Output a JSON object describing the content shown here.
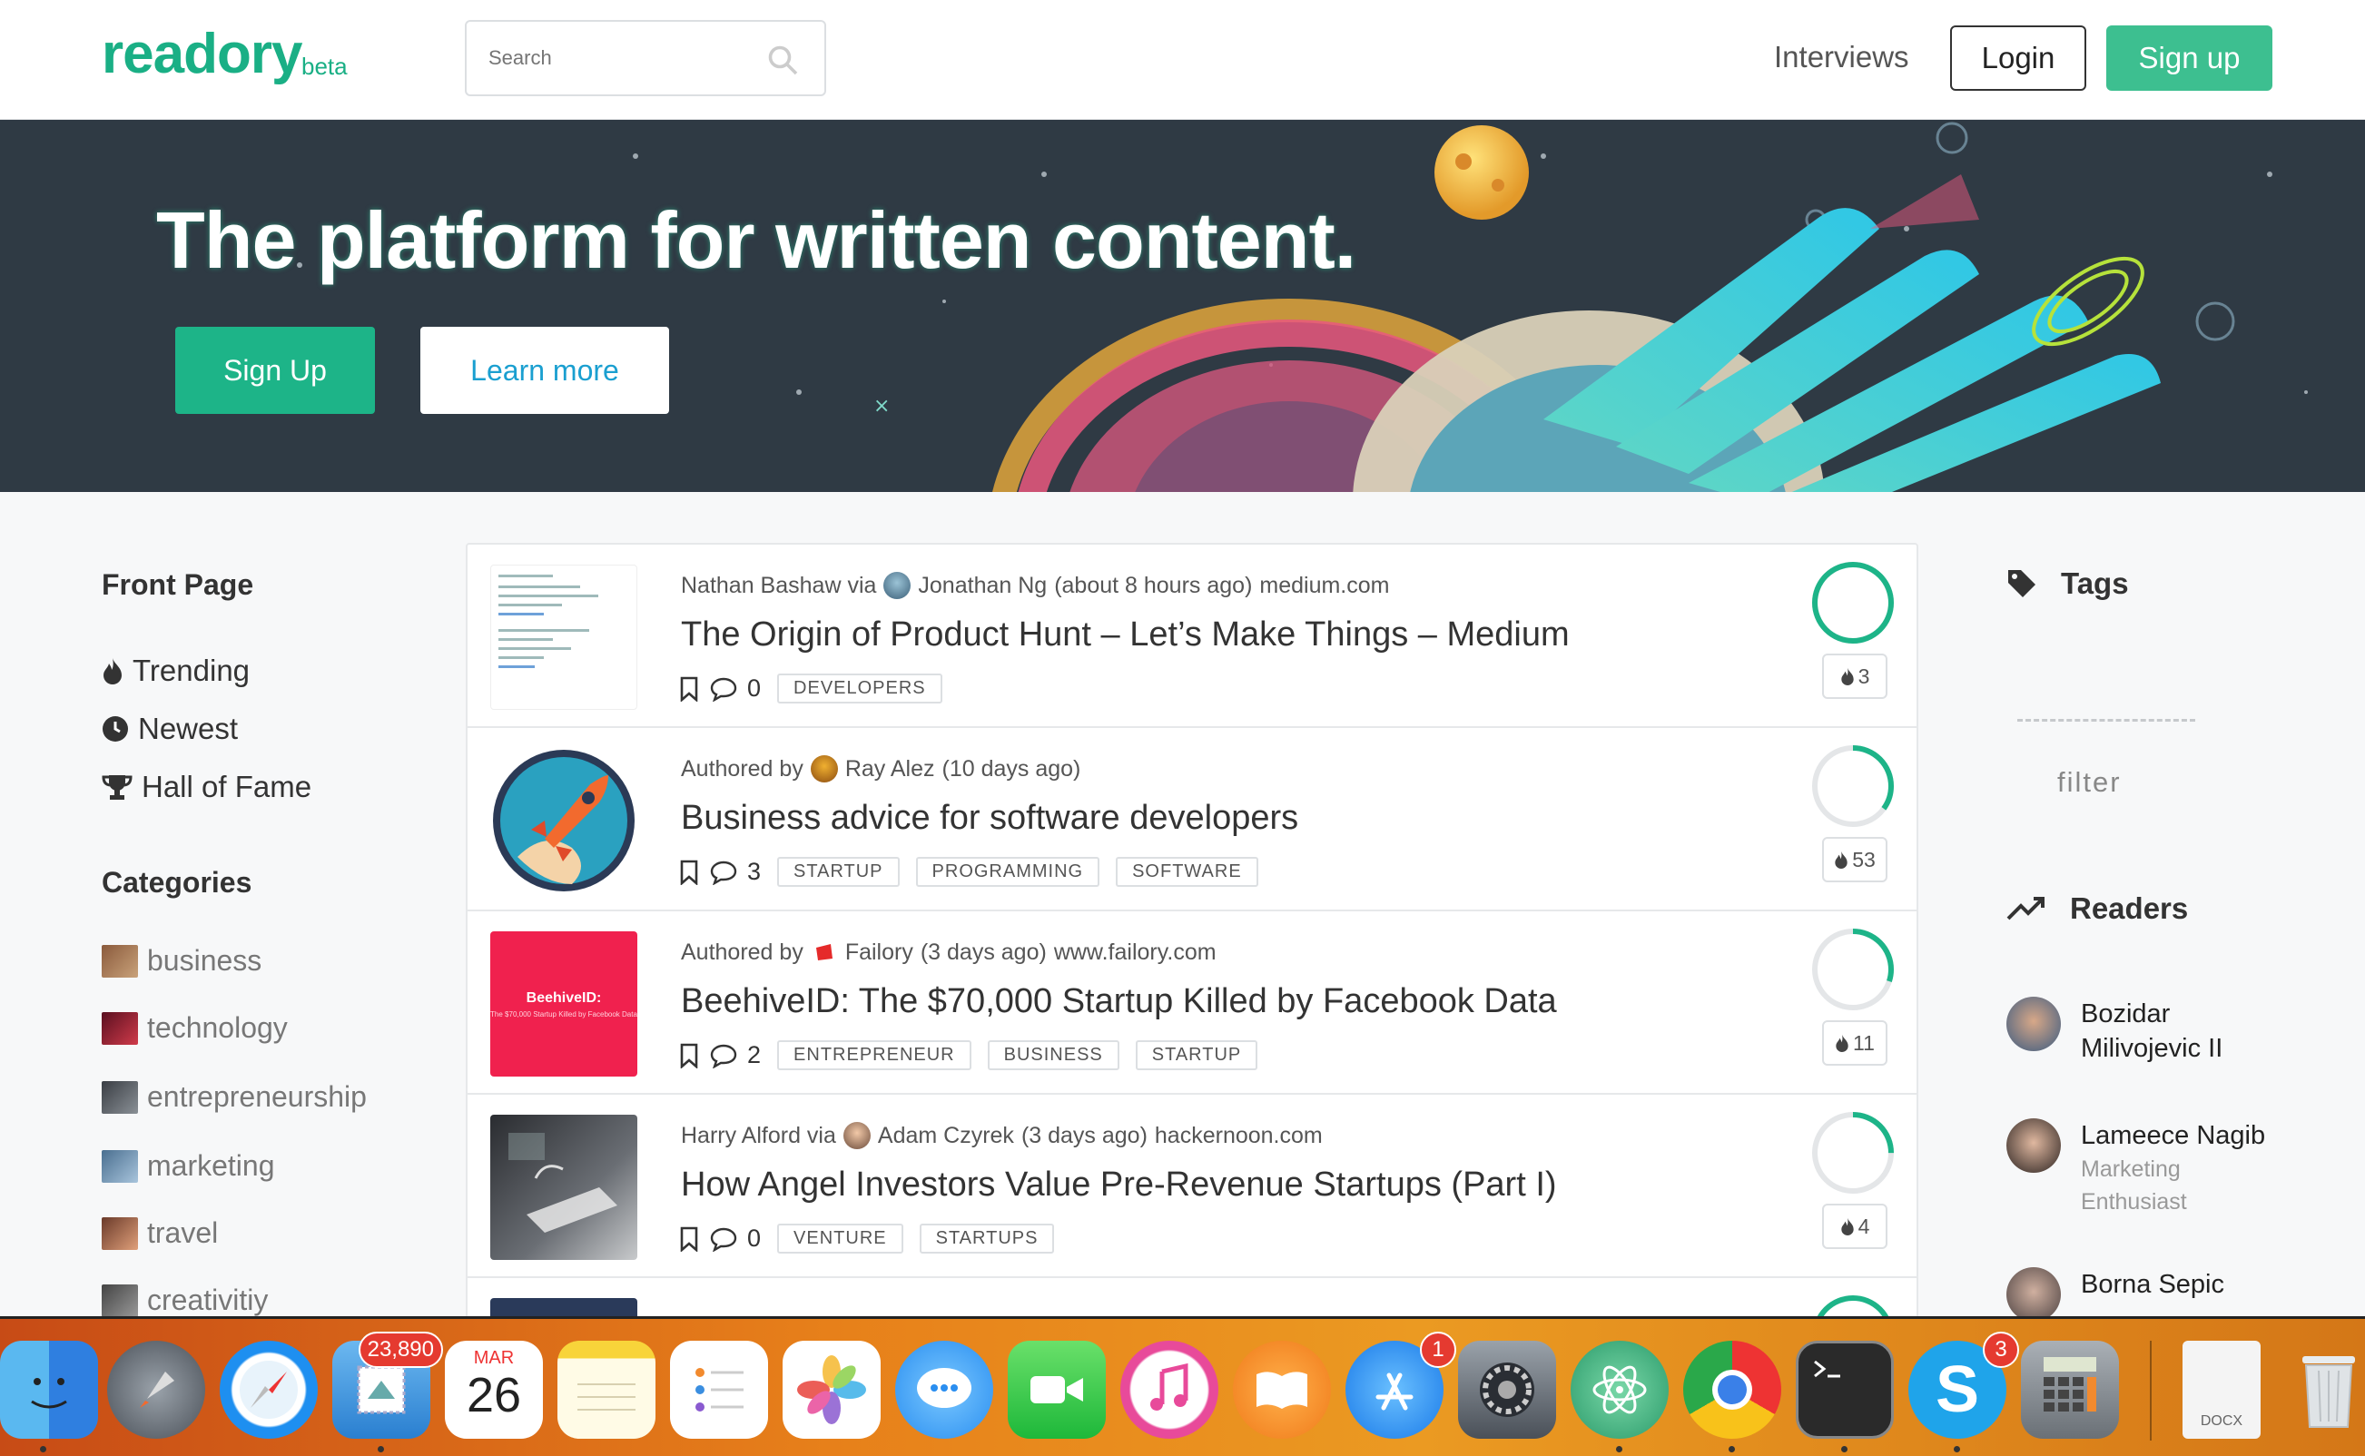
{
  "header": {
    "logo": "readory",
    "badge": "beta",
    "search_placeholder": "Search",
    "nav_interviews": "Interviews",
    "login_label": "Login",
    "signup_label": "Sign up"
  },
  "hero": {
    "title": "The platform for written content.",
    "signup_label": "Sign Up",
    "learn_more_label": "Learn more"
  },
  "sidebar": {
    "front_page_title": "Front Page",
    "nav": [
      {
        "label": "Trending",
        "icon": "flame-icon"
      },
      {
        "label": "Newest",
        "icon": "clock-icon"
      },
      {
        "label": "Hall of Fame",
        "icon": "trophy-icon"
      }
    ],
    "categories_title": "Categories",
    "categories": [
      {
        "label": "business",
        "color": "#8a5a3c"
      },
      {
        "label": "technology",
        "color": "#9a1f2c"
      },
      {
        "label": "entrepreneurship",
        "color": "#555a60"
      },
      {
        "label": "marketing",
        "color": "#6a8fb0"
      },
      {
        "label": "travel",
        "color": "#b06a4a"
      },
      {
        "label": "creativitiy",
        "color": "#6a6a6a"
      }
    ]
  },
  "feed": [
    {
      "author_prefix": "Nathan Bashaw via",
      "author": "Jonathan Ng",
      "time": "(about 8 hours ago)",
      "source": "medium.com",
      "title": "The Origin of Product Hunt – Let’s Make Things – Medium",
      "comments": "0",
      "tags": [
        "DEVELOPERS"
      ],
      "score": "3",
      "progress": 1.0
    },
    {
      "author_prefix": "Authored by",
      "author": "Ray Alez",
      "time": "(10 days ago)",
      "source": "",
      "title": "Business advice for software developers",
      "comments": "3",
      "tags": [
        "STARTUP",
        "PROGRAMMING",
        "SOFTWARE"
      ],
      "score": "53",
      "progress": 0.35
    },
    {
      "author_prefix": "Authored by",
      "author": "Failory",
      "time": "(3 days ago)",
      "source": "www.failory.com",
      "title": "BeehiveID: The $70,000 Startup Killed by Facebook Data",
      "comments": "2",
      "tags": [
        "ENTREPRENEUR",
        "BUSINESS",
        "STARTUP"
      ],
      "score": "11",
      "progress": 0.3,
      "thumb_text": "BeehiveID:",
      "thumb_sub": "The $70,000 Startup Killed by Facebook Data"
    },
    {
      "author_prefix": "Harry Alford via",
      "author": "Adam Czyrek",
      "time": "(3 days ago)",
      "source": "hackernoon.com",
      "title": "How Angel Investors Value Pre-Revenue Startups (Part I)",
      "comments": "0",
      "tags": [
        "VENTURE",
        "STARTUPS"
      ],
      "score": "4",
      "progress": 0.25
    }
  ],
  "right": {
    "tags_title": "Tags",
    "filter_label": "filter",
    "readers_title": "Readers",
    "readers": [
      {
        "name": "Bozidar Milivojevic II",
        "desc": ""
      },
      {
        "name": "Lameece Nagib",
        "desc": "Marketing Enthusiast"
      },
      {
        "name": "Borna Sepic",
        "desc": ""
      }
    ]
  },
  "dock": {
    "mail_badge": "23,890",
    "calendar_month": "MAR",
    "calendar_day": "26",
    "appstore_badge": "1",
    "skype_badge": "3",
    "file_label": "DOCX"
  },
  "colors": {
    "brand": "#1aaf85",
    "accent": "#3dbf90",
    "hero_bg": "#2f3a44"
  }
}
